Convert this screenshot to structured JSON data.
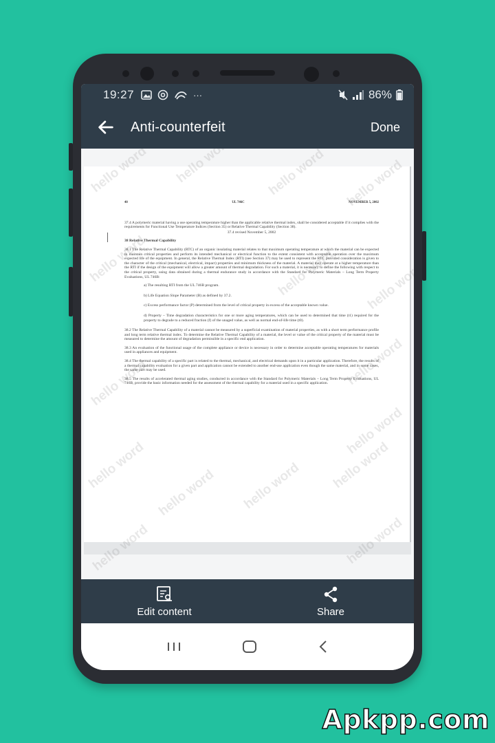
{
  "status_bar": {
    "time": "19:27",
    "battery": "86%",
    "left_icons": [
      "image-icon",
      "at-icon",
      "swipe-icon",
      "more-dots-icon"
    ],
    "right_icons": [
      "mute-icon",
      "signal-icon",
      "battery-icon"
    ],
    "more": "···"
  },
  "app_bar": {
    "title": "Anti-counterfeit",
    "done_label": "Done"
  },
  "document": {
    "header_left": "40",
    "header_center": "UL 746C",
    "header_right": "NOVEMBER 5, 2002",
    "p_37_4": "37.4 A polymeric material having a use operating temperature higher than the applicable relative thermal index, shall be considered acceptable if it complies with the requirements for Functional Use Temperature Indices (Section 35) or Relative Thermal Capability (Section 38).",
    "revised_37_4": "37.4 revised November 5, 2002",
    "heading_38": "38 Relative Thermal Capability",
    "p_38_1": "38.1 The Relative Thermal Capability (RTC) of an organic insulating material relates to that maximum operating temperature at which the material can be expected to maintain critical properties and perform its intended mechanical or electrical function to the extent consistent with acceptable operation over the maximum expected life of the equipment. In general, the Relative Thermal Index (RTI) (see Section 37) may be used to represent the RTC provided consideration is given to the character of the critical (mechanical, electrical, impact) properties and minimum thickness of the material. A material may operate at a higher temperature than the RTI if the design of the equipment will allow a greater amount of thermal degradation. For such a material, it is necessary to define the following with respect to the critical property, using data obtained during a thermal endurance study in accordance with the Standard for Polymeric Materials – Long Term Property Evaluations, UL 746B:",
    "item_a": "a) The resulting RTI from the UL 746B program.",
    "item_b": "b) Life Equation Slope Parameter (B) as defined by 37.2.",
    "item_c": "c) Excess performance factor (P) determined from the level of critical property in excess of the acceptable known value.",
    "item_d": "d) Property – Time degradation characteristics for one or more aging temperatures, which can be used to determined that time (t1) required for the property to degrade to a reduced fraction (f) of the unaged value, as well as normal end-of-life time (t0).",
    "p_38_2": "38.2 The Relative Thermal Capability of a material cannot be measured by a superficial examination of material properties, as with a short term performance profile and long term relative thermal index. To determine the Relative Thermal Capability of a material, the level or value of the critical property of the material must be measured to determine the amount of degradation permissible in a specific end application.",
    "p_38_3": "38.3 An evaluation of the functional usage of the complete appliance or device is necessary in order to determine acceptable operating temperatures for materials used in appliances and equipment.",
    "p_38_4": "38.4 The thermal capability of a specific part is related to the thermal, mechanical, and electrical demands upon it in a particular application. Therefore, the results of a thermal capability evaluation for a given part and application cannot be extended to another end-use application even though the same material, and in some cases, the same part may be used.",
    "p_38_5": "38.5 The results of accelerated thermal aging studies, conducted in accordance with the Standard for Polymeric Materials – Long Term Property Evaluations, UL 746B, provide the basic information needed for the assessment of the thermal capability for a material used in a specific application.",
    "watermark_text": "hello word"
  },
  "bottom_actions": {
    "edit_label": "Edit content",
    "share_label": "Share"
  },
  "site_watermark": "Apkpp.com",
  "colors": {
    "background": "#22c19f",
    "app_bar": "#2f3d49"
  }
}
